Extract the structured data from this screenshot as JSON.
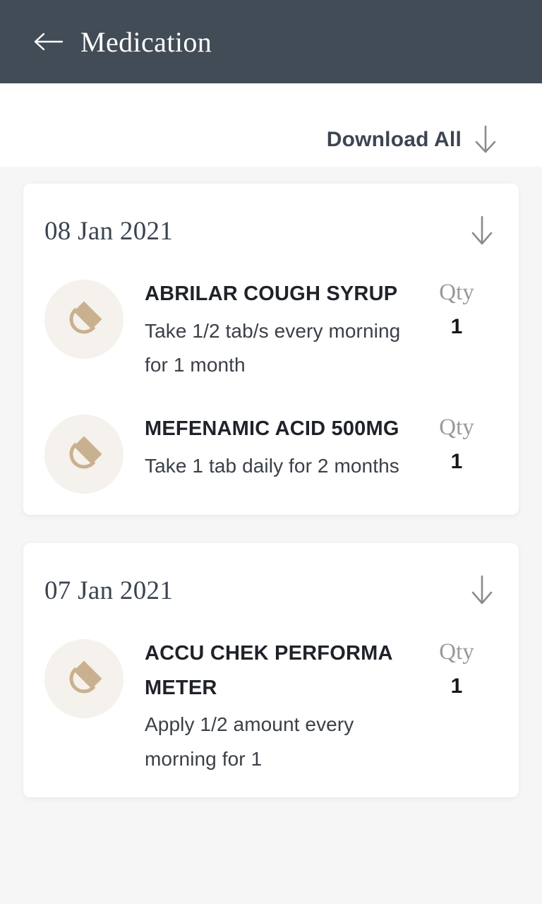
{
  "appbar": {
    "title": "Medication",
    "back_icon": "arrow-left-icon"
  },
  "toolbar": {
    "download_all_label": "Download All",
    "download_icon": "arrow-down-icon"
  },
  "colors": {
    "appbar_bg": "#424c56",
    "page_bg": "#f6f6f6",
    "card_bg": "#ffffff",
    "pill_accent": "#c9b18f",
    "pill_circle_bg": "#f5f1ec",
    "qty_label": "#9a9a9a",
    "text_primary": "#1f2329"
  },
  "groups": [
    {
      "date": "08 Jan 2021",
      "expand_icon": "arrow-down-icon",
      "items": [
        {
          "icon": "pill-icon",
          "name": "ABRILAR COUGH SYRUP",
          "dose": "Take 1/2 tab/s every morning for 1 month",
          "qty_label": "Qty",
          "qty_value": "1"
        },
        {
          "icon": "pill-icon",
          "name": "MEFENAMIC ACID 500MG",
          "dose": "Take 1 tab daily for 2 months",
          "qty_label": "Qty",
          "qty_value": "1"
        }
      ]
    },
    {
      "date": "07 Jan 2021",
      "expand_icon": "arrow-down-icon",
      "items": [
        {
          "icon": "pill-icon",
          "name": "ACCU CHEK PERFORMA METER",
          "dose": "Apply 1/2 amount every morning for 1",
          "qty_label": "Qty",
          "qty_value": "1"
        }
      ]
    }
  ]
}
